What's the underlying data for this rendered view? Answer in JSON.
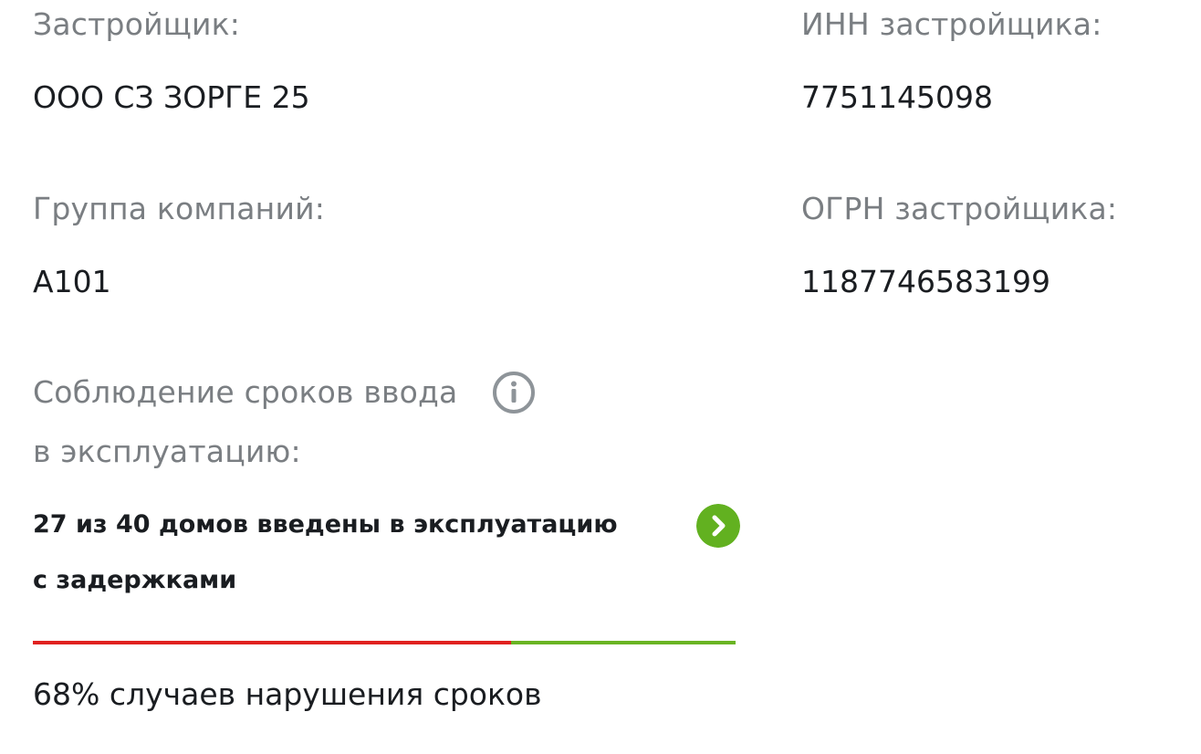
{
  "developer": {
    "label": "Застройщик:",
    "value": "ООО СЗ ЗОРГЕ 25"
  },
  "inn": {
    "label": "ИНН застройщика:",
    "value": "7751145098"
  },
  "group": {
    "label": "Группа компаний:",
    "value": "А101"
  },
  "ogrn": {
    "label": "ОГРН застройщика:",
    "value": "1187746583199"
  },
  "compliance": {
    "label_line1": "Соблюдение сроков ввода",
    "label_line2": "в эксплуатацию:",
    "summary_line1": "27 из 40 домов введены в эксплуатацию",
    "summary_line2": "с задержками",
    "violation_text": "68% случаев нарушения сроков",
    "violation_fraction": 0.68
  },
  "colors": {
    "label": "#7a7e82",
    "value": "#1a1d21",
    "progress_violation": "#e0211f",
    "progress_ok": "#6ab423",
    "arrow_button": "#62b120",
    "info_icon": "#8e9499"
  },
  "icons": {
    "info": "info-icon",
    "arrow": "chevron-right-icon"
  }
}
